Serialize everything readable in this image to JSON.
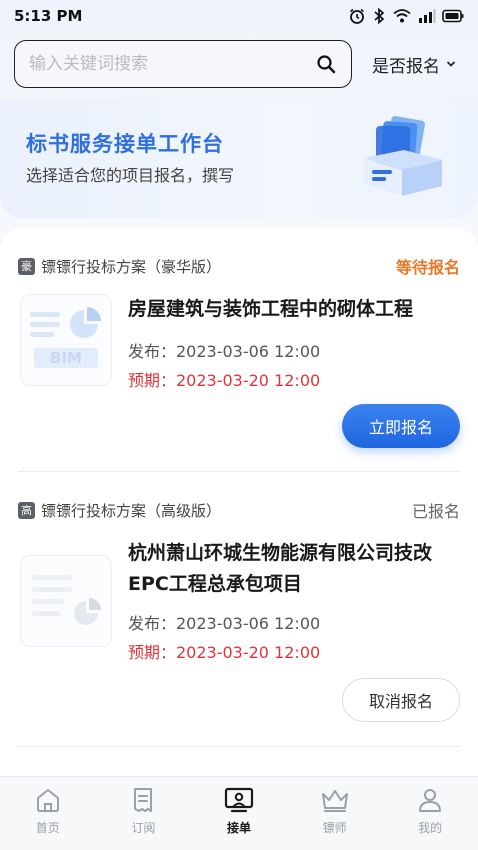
{
  "status_bar": {
    "time": "5:13 PM",
    "icons": [
      "alarm-icon",
      "bluetooth-icon",
      "wifi-icon",
      "signal-icon",
      "battery-icon"
    ]
  },
  "search": {
    "placeholder": "输入关键词搜索",
    "value": "",
    "filter_label": "是否报名"
  },
  "banner": {
    "title": "标书服务接单工作台",
    "subtitle": "选择适合您的项目报名，撰写"
  },
  "items": [
    {
      "plan_badge": "豪",
      "plan_name": "镖镖行投标方案（豪华版）",
      "status": "等待报名",
      "thumb_label": "BIM",
      "title": "房屋建筑与装饰工程中的砌体工程",
      "publish": "发布：2023-03-06 12:00",
      "due": "预期：2023-03-20 12:00",
      "action": "立即报名"
    },
    {
      "plan_badge": "高",
      "plan_name": "镖镖行投标方案（高级版）",
      "status": "已报名",
      "title": "杭州萧山环城生物能源有限公司技改EPC工程总承包项目",
      "publish": "发布：2023-03-06 12:00",
      "due": "预期：2023-03-20 12:00",
      "action": "取消报名"
    }
  ],
  "tabs": [
    {
      "label": "首页",
      "icon": "home-icon",
      "active": false
    },
    {
      "label": "订阅",
      "icon": "receipt-icon",
      "active": false
    },
    {
      "label": "接单",
      "icon": "order-screen-icon",
      "active": true
    },
    {
      "label": "镖师",
      "icon": "crown-icon",
      "active": false
    },
    {
      "label": "我的",
      "icon": "person-icon",
      "active": false
    }
  ],
  "colors": {
    "accent": "#2f6fe0",
    "waiting": "#e8792a",
    "due": "#e0343a"
  }
}
